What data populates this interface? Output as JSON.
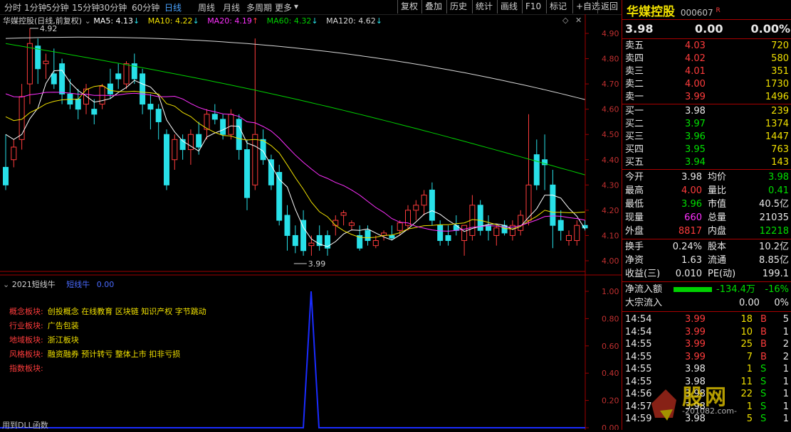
{
  "toolbar": {
    "periods": [
      "分时",
      "1分钟",
      "5分钟",
      "15分钟",
      "30分钟",
      "60分钟",
      "日线",
      "周线",
      "月线",
      "多周期",
      "更多"
    ],
    "active_period": "日线",
    "right_buttons": [
      "复权",
      "叠加",
      "历史",
      "统计",
      "画线",
      "F10",
      "标记",
      "+自选",
      "返回"
    ]
  },
  "chart_header": {
    "title": "华媒控股(日线,前复权)",
    "ma5": "MA5: 4.13",
    "ma10": "MA10: 4.22",
    "ma20": "MA20: 4.19",
    "ma60": "MA60: 4.32",
    "ma120": "MA120: 4.62",
    "high_label": "4.92",
    "low_label": "3.99"
  },
  "price_axis": [
    "4.90",
    "4.80",
    "4.70",
    "4.60",
    "4.50",
    "4.40",
    "4.30",
    "4.20",
    "4.10",
    "4.00"
  ],
  "indicator": {
    "title": "2021短线牛",
    "name": "短线牛",
    "value": "0.00",
    "axis": [
      "1.00",
      "0.80",
      "0.60",
      "0.40",
      "0.20",
      "0.00"
    ],
    "bottom_note": "用到DLL函数",
    "info": [
      {
        "label": "概念板块:",
        "value": "创投概念 在线教育 区块链 知识产权 字节跳动"
      },
      {
        "label": "行业板块:",
        "value": "广告包装"
      },
      {
        "label": "地域板块:",
        "value": "浙江板块"
      },
      {
        "label": "风格板块:",
        "value": "融资融券 预计转亏 整体上市 扣非亏损"
      },
      {
        "label": "指数板块:",
        "value": ""
      }
    ]
  },
  "quote": {
    "name": "华媒控股",
    "code": "000607",
    "badge": "R",
    "price": "3.98",
    "change": "0.00",
    "pct": "0.00%",
    "asks": [
      {
        "label": "卖五",
        "price": "4.03",
        "vol": "720"
      },
      {
        "label": "卖四",
        "price": "4.02",
        "vol": "580"
      },
      {
        "label": "卖三",
        "price": "4.01",
        "vol": "351"
      },
      {
        "label": "卖二",
        "price": "4.00",
        "vol": "1730"
      },
      {
        "label": "卖一",
        "price": "3.99",
        "vol": "1496"
      }
    ],
    "bids": [
      {
        "label": "买一",
        "price": "3.98",
        "vol": "239"
      },
      {
        "label": "买二",
        "price": "3.97",
        "vol": "1374"
      },
      {
        "label": "买三",
        "price": "3.96",
        "vol": "1447"
      },
      {
        "label": "买四",
        "price": "3.95",
        "vol": "763"
      },
      {
        "label": "买五",
        "price": "3.94",
        "vol": "143"
      }
    ],
    "stats": [
      {
        "l1": "今开",
        "v1": "3.98",
        "c1": "white",
        "l2": "均价",
        "v2": "3.98",
        "c2": "green"
      },
      {
        "l1": "最高",
        "v1": "4.00",
        "c1": "red",
        "l2": "量比",
        "v2": "0.41",
        "c2": "green"
      },
      {
        "l1": "最低",
        "v1": "3.96",
        "c1": "green",
        "l2": "市值",
        "v2": "40.5亿",
        "c2": "white"
      },
      {
        "l1": "现量",
        "v1": "660",
        "c1": "magenta",
        "l2": "总量",
        "v2": "21035",
        "c2": "white"
      },
      {
        "l1": "外盘",
        "v1": "8817",
        "c1": "red",
        "l2": "内盘",
        "v2": "12218",
        "c2": "green"
      }
    ],
    "fin": [
      {
        "l1": "换手",
        "v1": "0.24%",
        "l2": "股本",
        "v2": "10.2亿"
      },
      {
        "l1": "净资",
        "v1": "1.63",
        "l2": "流通",
        "v2": "8.85亿"
      },
      {
        "l1": "收益(三)",
        "v1": "0.010",
        "l2": "PE(动)",
        "v2": "199.1"
      }
    ],
    "netflow": {
      "label": "净流入额",
      "value": "-134.4万",
      "pct": "-16%"
    },
    "bigflow": {
      "label": "大宗流入",
      "value": "0.00",
      "pct": "0%"
    },
    "ticks": [
      {
        "t": "14:54",
        "p": "3.99",
        "v": "18",
        "bs": "B",
        "n": "5"
      },
      {
        "t": "14:54",
        "p": "3.99",
        "v": "10",
        "bs": "B",
        "n": "1"
      },
      {
        "t": "14:55",
        "p": "3.99",
        "v": "25",
        "bs": "B",
        "n": "2"
      },
      {
        "t": "14:55",
        "p": "3.99",
        "v": "7",
        "bs": "B",
        "n": "2"
      },
      {
        "t": "14:55",
        "p": "3.98",
        "v": "1",
        "bs": "S",
        "n": "1"
      },
      {
        "t": "14:55",
        "p": "3.98",
        "v": "11",
        "bs": "S",
        "n": "1"
      },
      {
        "t": "14:56",
        "p": "3.98",
        "v": "22",
        "bs": "S",
        "n": "1"
      },
      {
        "t": "14:57",
        "p": "3.98",
        "v": "1",
        "bs": "S",
        "n": "1"
      },
      {
        "t": "14:59",
        "p": "3.98",
        "v": "5",
        "bs": "S",
        "n": "1"
      }
    ]
  },
  "watermark": {
    "big": "股网",
    "sub": "-201082.com-"
  },
  "colors": {
    "up": "#ff3c3c",
    "down": "#28e0e8",
    "ma5": "#ffffff",
    "ma10": "#f0e000",
    "ma20": "#ff30ff",
    "ma60": "#00d000",
    "ma120": "#d8d8d8"
  }
}
